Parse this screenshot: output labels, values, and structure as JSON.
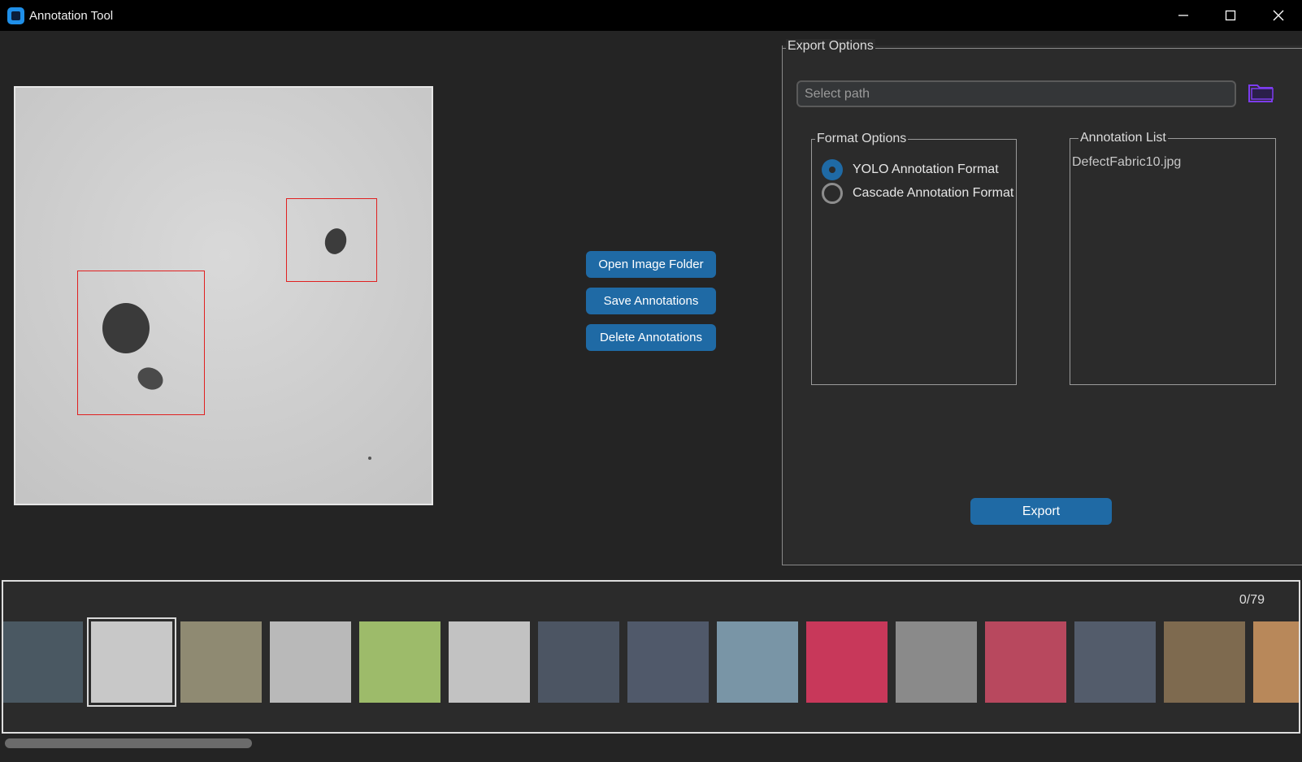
{
  "window": {
    "title": "Annotation Tool",
    "controls": [
      "minimize",
      "maximize",
      "close"
    ]
  },
  "actions": {
    "open_folder": "Open Image Folder",
    "save": "Save Annotations",
    "delete": "Delete Annotations"
  },
  "export_panel": {
    "legend": "Export Options",
    "path_placeholder": "Select path",
    "folder_icon": "folder-icon",
    "format_legend": "Format Options",
    "formats": [
      {
        "label": "YOLO Annotation Format",
        "selected": true
      },
      {
        "label": "Cascade Annotation Format",
        "selected": false
      }
    ],
    "annotation_list_legend": "Annotation List",
    "annotation_items": [
      "DefectFabric10.jpg"
    ],
    "export_label": "Export"
  },
  "gallery": {
    "counter": "0/79",
    "selected_index": 1,
    "thumbnail_colors": [
      "#4a5862",
      "#c8c8c8",
      "#8f8a72",
      "#b9b9b9",
      "#9dbb6a",
      "#c2c2c2",
      "#4c5563",
      "#50596a",
      "#7995a6",
      "#c8385a",
      "#8a8a8a",
      "#b8485e",
      "#535c6b",
      "#7e6a4f",
      "#b8885a"
    ]
  },
  "colors": {
    "accent": "#1f6aa5",
    "bbox": "#e02020",
    "folder_icon": "#7c3cf0"
  }
}
